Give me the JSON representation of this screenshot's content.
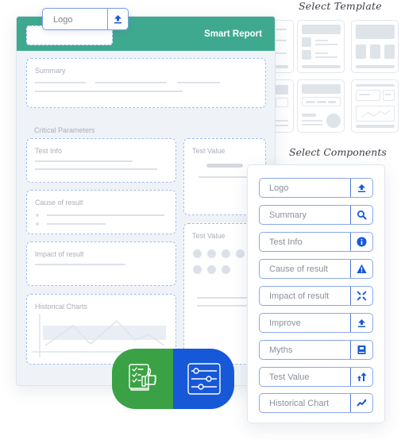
{
  "templates": {
    "title": "Select Template",
    "thumbnails": [
      "template-1",
      "template-2",
      "template-3",
      "template-4",
      "template-5",
      "template-6"
    ]
  },
  "report": {
    "title": "Smart Report",
    "header_color": "#3fa98f",
    "logo_input": {
      "value": "Logo",
      "icon": "upload-icon"
    },
    "sections": {
      "summary": "Summary",
      "critical_parameters": "Critical Parameters",
      "test_info": "Test Info",
      "test_value_1": "Test Value",
      "cause_of_result": "Cause of result",
      "test_value_2": "Test Value",
      "impact_of_result": "Impact of result",
      "historical_charts": "Historical Charts"
    }
  },
  "components": {
    "title": "Select Components",
    "accent_color": "#1658d8",
    "items": [
      {
        "label": "Logo",
        "icon": "upload-icon"
      },
      {
        "label": "Summary",
        "icon": "search-icon"
      },
      {
        "label": "Test Info",
        "icon": "info-icon"
      },
      {
        "label": "Cause of result",
        "icon": "warning-icon"
      },
      {
        "label": "Impact of result",
        "icon": "collapse-arrows-icon"
      },
      {
        "label": "Improve",
        "icon": "upload-icon"
      },
      {
        "label": "Myths",
        "icon": "book-icon"
      },
      {
        "label": "Test Value",
        "icon": "sort-arrows-icon"
      },
      {
        "label": "Historical Chart",
        "icon": "trend-chart-icon"
      }
    ]
  },
  "badges": {
    "left": {
      "icon": "checklist-thumbs-up-icon",
      "color": "#3aa244"
    },
    "right": {
      "icon": "sliders-icon",
      "color": "#1658d8"
    }
  }
}
